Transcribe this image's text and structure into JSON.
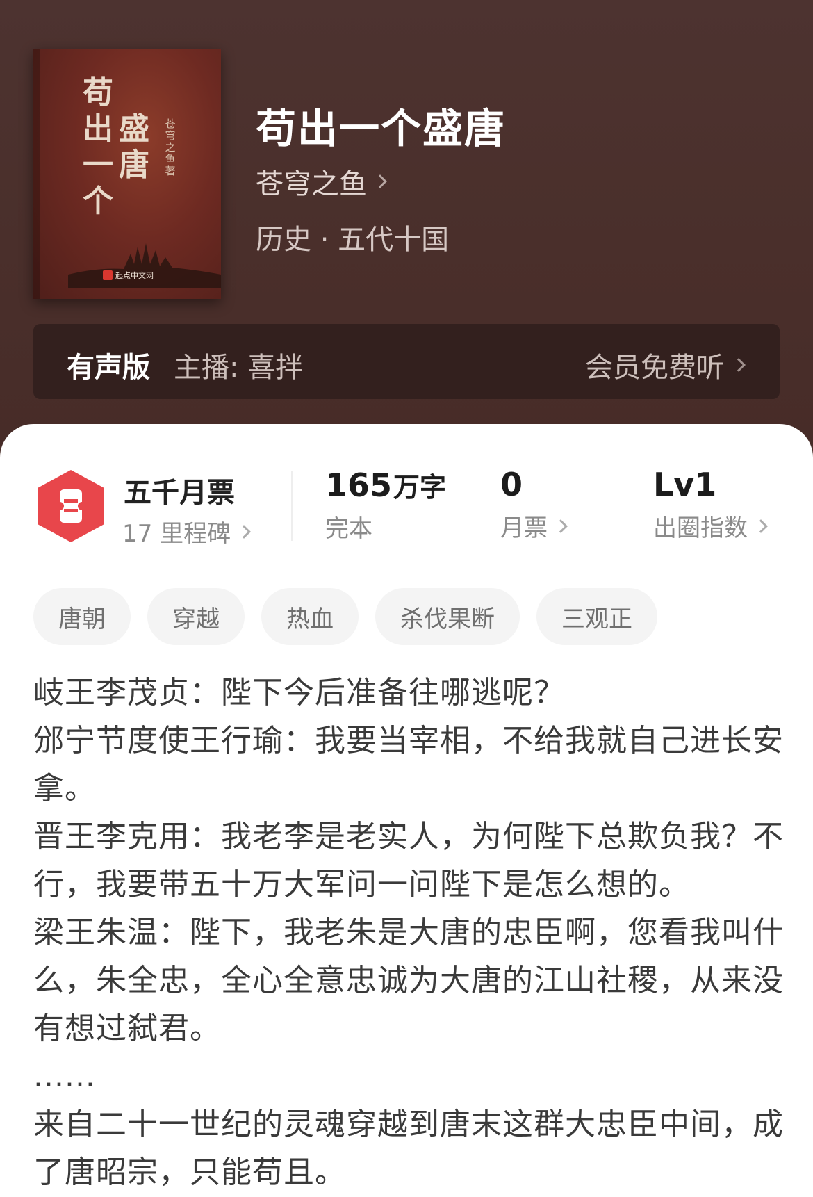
{
  "book": {
    "title": "苟出一个盛唐",
    "author": "苍穹之鱼",
    "genre": "历史 · 五代十国",
    "cover": {
      "col1": "苟出一个",
      "col2": "盛唐",
      "author_vertical": "苍穹之鱼 著",
      "publisher": "起点中文网"
    }
  },
  "audio": {
    "badge": "有声版",
    "narrator": "主播: 喜拌",
    "listen_label": "会员免费听"
  },
  "stats": {
    "milestone_title": "五千月票",
    "milestone_sub": "17 里程碑",
    "words_value": "165",
    "words_unit": "万字",
    "words_label": "完本",
    "monthly_value": "0",
    "monthly_label": "月票",
    "level_value": "Lv1",
    "level_label": "出圈指数"
  },
  "tags": [
    "唐朝",
    "穿越",
    "热血",
    "杀伐果断",
    "三观正"
  ],
  "synopsis": [
    "岐王李茂贞：陛下今后准备往哪逃呢？",
    "邠宁节度使王行瑜：我要当宰相，不给我就自己进长安拿。",
    "晋王李克用：我老李是老实人，为何陛下总欺负我？不行，我要带五十万大军问一问陛下是怎么想的。",
    "梁王朱温：陛下，我老朱是大唐的忠臣啊，您看我叫什么，朱全忠，全心全意忠诚为大唐的江山社稷，从来没有想过弑君。",
    "......",
    "来自二十一世纪的灵魂穿越到唐末这群大忠臣中间，成了唐昭宗，只能苟且。"
  ],
  "colors": {
    "hero_bg": "#4a302c",
    "audio_bar_bg": "#33201e",
    "badge_red": "#e8464b"
  }
}
